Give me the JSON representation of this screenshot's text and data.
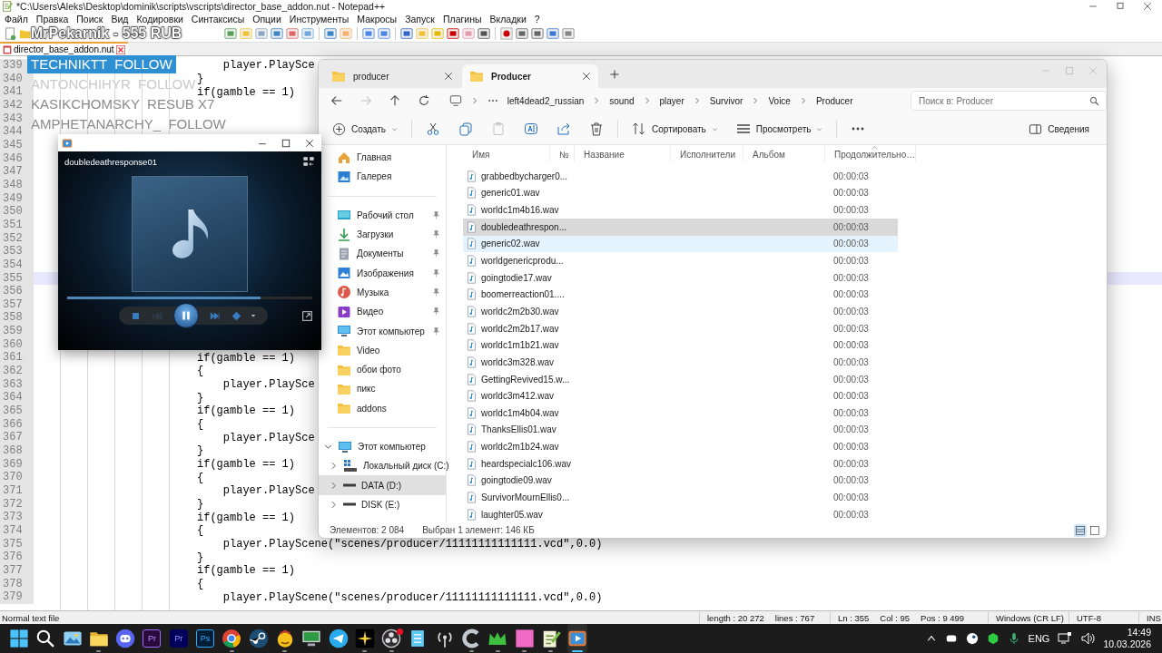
{
  "notepad": {
    "title": "*C:\\Users\\Aleks\\Desktop\\dominik\\scripts\\vscripts\\director_base_addon.nut - Notepad++",
    "menu": [
      "Файл",
      "Правка",
      "Поиск",
      "Вид",
      "Кодировки",
      "Синтаксисы",
      "Опции",
      "Инструменты",
      "Макросы",
      "Запуск",
      "Плагины",
      "Вкладки",
      "?"
    ],
    "tabs": [
      {
        "label": "director_base_addon.nut",
        "selected": true
      }
    ],
    "lines": [
      {
        "number": "339",
        "code": "    player.PlaySce",
        "current": false
      },
      {
        "number": "340",
        "code": "}",
        "current": false
      },
      {
        "number": "341",
        "code": "if(gamble == 1)",
        "current": false
      },
      {
        "number": "342",
        "current": false
      },
      {
        "number": "343",
        "current": false
      },
      {
        "number": "344",
        "current": false
      },
      {
        "number": "345",
        "current": false
      },
      {
        "number": "346",
        "current": false
      },
      {
        "number": "347",
        "current": false
      },
      {
        "number": "348",
        "current": false
      },
      {
        "number": "349",
        "current": false
      },
      {
        "number": "350",
        "current": false
      },
      {
        "number": "351",
        "current": false
      },
      {
        "number": "352",
        "current": false
      },
      {
        "number": "353",
        "current": false
      },
      {
        "number": "354",
        "current": false
      },
      {
        "number": "355",
        "current": true
      },
      {
        "number": "356",
        "current": false
      },
      {
        "number": "357",
        "current": false
      },
      {
        "number": "358",
        "current": false
      },
      {
        "number": "359",
        "current": false
      },
      {
        "number": "360",
        "current": false
      },
      {
        "number": "361",
        "code": "if(gamble == 1)",
        "current": false
      },
      {
        "number": "362",
        "code": "{",
        "current": false
      },
      {
        "number": "363",
        "code": "    player.PlaySce",
        "current": false
      },
      {
        "number": "364",
        "code": "}",
        "current": false
      },
      {
        "number": "365",
        "code": "if(gamble == 1)",
        "current": false
      },
      {
        "number": "366",
        "code": "{",
        "current": false
      },
      {
        "number": "367",
        "code": "    player.PlaySce",
        "current": false
      },
      {
        "number": "368",
        "code": "}",
        "current": false
      },
      {
        "number": "369",
        "code": "if(gamble == 1)",
        "current": false
      },
      {
        "number": "370",
        "code": "{",
        "current": false
      },
      {
        "number": "371",
        "code": "    player.PlaySce",
        "current": false
      },
      {
        "number": "372",
        "code": "}",
        "current": false
      },
      {
        "number": "373",
        "code": "if(gamble == 1)",
        "current": false
      },
      {
        "number": "374",
        "code": "{",
        "current": false
      },
      {
        "number": "375",
        "code": "    player.PlayScene(\"scenes/producer/11111111111111.vcd\",0.0)",
        "current": false
      },
      {
        "number": "376",
        "code": "}",
        "current": false
      },
      {
        "number": "377",
        "code": "if(gamble == 1)",
        "current": false
      },
      {
        "number": "378",
        "code": "{",
        "current": false
      },
      {
        "number": "379",
        "code": "    player.PlayScene(\"scenes/producer/11111111111111.vcd\",0.0)",
        "current": false
      }
    ],
    "status": {
      "file_type": "Normal text file",
      "length": "length : 20 272",
      "lines": "lines : 767",
      "ln": "Ln : 355",
      "col": "Col : 95",
      "pos": "Pos : 9 499",
      "eol": "Windows (CR LF)",
      "encoding": "UTF-8",
      "mode": "INS"
    }
  },
  "explorer": {
    "tabs": [
      {
        "label": "producer",
        "selected": false
      },
      {
        "label": "Producer",
        "selected": true
      }
    ],
    "nav": [
      {
        "kind": "back",
        "disabled": false
      },
      {
        "kind": "forward",
        "disabled": true
      },
      {
        "kind": "up",
        "disabled": false
      },
      {
        "kind": "refresh",
        "disabled": false
      }
    ],
    "breadcrumb": [
      "left4dead2_russian",
      "sound",
      "player",
      "Survivor",
      "Voice",
      "Producer"
    ],
    "search": {
      "placeholder": "Поиск в: Producer"
    },
    "commands": [
      {
        "kind": "new",
        "label": "Создать",
        "dropdown": true,
        "disabled": false
      },
      {
        "kind": "cut",
        "dropdown": false,
        "disabled": false
      },
      {
        "kind": "copy",
        "dropdown": false,
        "disabled": false
      },
      {
        "kind": "paste",
        "dropdown": false,
        "disabled": true
      },
      {
        "kind": "rename",
        "dropdown": false,
        "disabled": false
      },
      {
        "kind": "share",
        "dropdown": false,
        "disabled": false
      },
      {
        "kind": "delete",
        "dropdown": false,
        "disabled": false
      },
      {
        "kind": "sort",
        "label": "Сортировать",
        "dropdown": true,
        "disabled": false
      },
      {
        "kind": "view",
        "label": "Просмотреть",
        "dropdown": true,
        "disabled": false
      },
      {
        "kind": "more",
        "dropdown": false,
        "disabled": false
      }
    ],
    "details_button": "Сведения",
    "sidebar": {
      "top": [
        {
          "label": "Главная",
          "kind": "home"
        },
        {
          "label": "Галерея",
          "kind": "gallery"
        }
      ],
      "places": [
        {
          "label": "Рабочий стол",
          "kind": "desktop",
          "pinned": true
        },
        {
          "label": "Загрузки",
          "kind": "download",
          "pinned": true
        },
        {
          "label": "Документы",
          "kind": "document",
          "pinned": true
        },
        {
          "label": "Изображения",
          "kind": "pictures",
          "pinned": true
        },
        {
          "label": "Музыка",
          "kind": "music",
          "pinned": true
        },
        {
          "label": "Видео",
          "kind": "video",
          "pinned": true
        },
        {
          "label": "Этот компьютер",
          "kind": "computer",
          "pinned": true
        },
        {
          "label": "Video",
          "kind": "folder",
          "pinned": false
        },
        {
          "label": "обои фото",
          "kind": "folder",
          "pinned": false
        },
        {
          "label": "пикс",
          "kind": "folder",
          "pinned": false
        },
        {
          "label": "addons",
          "kind": "folder",
          "pinned": false
        }
      ],
      "tree": [
        {
          "label": "Этот компьютер",
          "kind": "computer",
          "expanded": true,
          "selected": false,
          "children": [
            {
              "label": "Локальный диск (C:)",
              "kind": "system-drive",
              "expanded": false,
              "selected": false
            },
            {
              "label": "DATA (D:)",
              "kind": "drive",
              "expanded": false,
              "selected": true
            },
            {
              "label": "DISK (E:)",
              "kind": "drive",
              "expanded": false,
              "selected": false
            }
          ]
        }
      ]
    },
    "columns": [
      {
        "label": "Имя",
        "sorted": false
      },
      {
        "label": "№",
        "sorted": false
      },
      {
        "label": "Название",
        "sorted": false
      },
      {
        "label": "Исполнители",
        "sorted": false
      },
      {
        "label": "Альбом",
        "sorted": false
      },
      {
        "label": "Продолжительно…",
        "sorted": true
      }
    ],
    "files": [
      {
        "name": "grabbedbycharger0...",
        "duration": "00:00:03",
        "selected": false,
        "hovered": false
      },
      {
        "name": "generic01.wav",
        "duration": "00:00:03",
        "selected": false,
        "hovered": false
      },
      {
        "name": "worldc1m4b16.wav",
        "duration": "00:00:03",
        "selected": false,
        "hovered": false
      },
      {
        "name": "doubledeathrespon...",
        "duration": "00:00:03",
        "selected": true,
        "hovered": false
      },
      {
        "name": "generic02.wav",
        "duration": "00:00:03",
        "selected": false,
        "hovered": true
      },
      {
        "name": "worldgenericprodu...",
        "duration": "00:00:03",
        "selected": false,
        "hovered": false
      },
      {
        "name": "goingtodie17.wav",
        "duration": "00:00:03",
        "selected": false,
        "hovered": false
      },
      {
        "name": "boomerreaction01....",
        "duration": "00:00:03",
        "selected": false,
        "hovered": false
      },
      {
        "name": "worldc2m2b30.wav",
        "duration": "00:00:03",
        "selected": false,
        "hovered": false
      },
      {
        "name": "worldc2m2b17.wav",
        "duration": "00:00:03",
        "selected": false,
        "hovered": false
      },
      {
        "name": "worldc1m1b21.wav",
        "duration": "00:00:03",
        "selected": false,
        "hovered": false
      },
      {
        "name": "worldc3m328.wav",
        "duration": "00:00:03",
        "selected": false,
        "hovered": false
      },
      {
        "name": "GettingRevived15.w...",
        "duration": "00:00:03",
        "selected": false,
        "hovered": false
      },
      {
        "name": "worldc3m412.wav",
        "duration": "00:00:03",
        "selected": false,
        "hovered": false
      },
      {
        "name": "worldc1m4b04.wav",
        "duration": "00:00:03",
        "selected": false,
        "hovered": false
      },
      {
        "name": "ThanksEllis01.wav",
        "duration": "00:00:03",
        "selected": false,
        "hovered": false
      },
      {
        "name": "worldc2m1b24.wav",
        "duration": "00:00:03",
        "selected": false,
        "hovered": false
      },
      {
        "name": "heardspecialc106.wav",
        "duration": "00:00:03",
        "selected": false,
        "hovered": false
      },
      {
        "name": "goingtodie09.wav",
        "duration": "00:00:03",
        "selected": false,
        "hovered": false
      },
      {
        "name": "SurvivorMournEllis0...",
        "duration": "00:00:03",
        "selected": false,
        "hovered": false
      },
      {
        "name": "laughter05.wav",
        "duration": "00:00:03",
        "selected": false,
        "hovered": false
      }
    ],
    "status": {
      "count": "Элементов: 2 084",
      "selection": "Выбран 1 элемент: 146 КБ"
    },
    "views": [
      {
        "kind": "details",
        "selected": true
      },
      {
        "kind": "tiles",
        "selected": false
      }
    ]
  },
  "player": {
    "track": "doubledeathresponse01",
    "level": 0.79,
    "playing": true
  },
  "taskbar": {
    "apps": [
      {
        "kind": "windows",
        "running": false,
        "active": false
      },
      {
        "kind": "search",
        "running": false,
        "active": false
      },
      {
        "kind": "landscape",
        "running": false,
        "active": false
      },
      {
        "kind": "folder",
        "running": true,
        "active": false
      },
      {
        "kind": "chat",
        "running": false,
        "active": false
      },
      {
        "kind": "letters-outline",
        "label": "Pr",
        "running": false,
        "active": false
      },
      {
        "kind": "letters-navy",
        "label": "Pr",
        "running": false,
        "active": false
      },
      {
        "kind": "letters-blue",
        "label": "Ps",
        "running": false,
        "active": false
      },
      {
        "kind": "browser",
        "running": true,
        "active": false
      },
      {
        "kind": "steam",
        "running": false,
        "active": false
      },
      {
        "kind": "smiley",
        "running": true,
        "active": false
      },
      {
        "kind": "computer",
        "running": false,
        "active": false
      },
      {
        "kind": "paper-plane",
        "running": false,
        "active": false
      },
      {
        "kind": "star",
        "running": true,
        "active": false
      },
      {
        "kind": "aperture",
        "running": true,
        "active": false
      },
      {
        "kind": "notepad",
        "running": false,
        "active": false
      },
      {
        "kind": "antenna",
        "running": false,
        "active": false
      },
      {
        "kind": "letter-c",
        "running": true,
        "active": false
      },
      {
        "kind": "crown",
        "running": true,
        "active": false
      },
      {
        "kind": "square",
        "running": true,
        "active": false
      },
      {
        "kind": "notepad-pen",
        "running": true,
        "active": false
      },
      {
        "kind": "player",
        "running": true,
        "active": true
      }
    ],
    "language": "ENG",
    "time": "14:49",
    "date": "10.03.2026"
  },
  "stream": {
    "donation": "MrPekarnik - 555 RUB",
    "alerts": [
      {
        "text": "TECHNIKTT  FOLLOW",
        "kind": "highlight"
      },
      {
        "text": "ANTONCHIHYR  FOLLOW",
        "kind": "faded"
      },
      {
        "text": "KASIKCHOMSKY  RESUB X7",
        "kind": "plain"
      },
      {
        "text": "AMPHETANARCHY_  FOLLOW",
        "kind": "plain"
      }
    ]
  }
}
